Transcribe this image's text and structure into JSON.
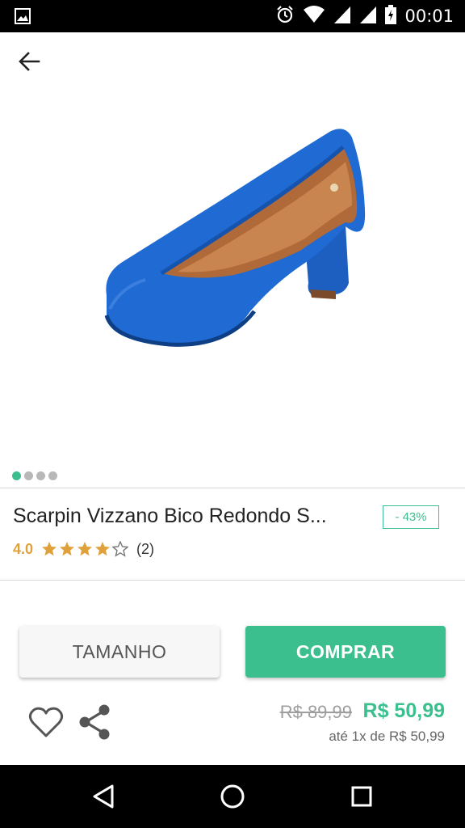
{
  "status_bar": {
    "time": "00:01",
    "icons": [
      "image-icon",
      "alarm-icon",
      "wifi-icon",
      "signal-icon",
      "signal-icon",
      "battery-icon"
    ]
  },
  "app_bar": {
    "back_icon": "arrow-back-icon"
  },
  "gallery": {
    "image_count": 4,
    "active_index": 0
  },
  "product": {
    "title": "Scarpin Vizzano Bico Redondo S...",
    "discount": "- 43%",
    "rating_value": "4.0",
    "rating_stars": 4,
    "rating_max": 5,
    "rating_count": "(2)"
  },
  "actions": {
    "size_label": "TAMANHO",
    "buy_label": "COMPRAR",
    "favorite_icon": "heart-icon",
    "share_icon": "share-icon"
  },
  "pricing": {
    "old_price": "R$ 89,99",
    "new_price": "R$ 50,99",
    "installment": "até 1x de R$ 50,99"
  },
  "nav_bar": {
    "icons": [
      "back-triangle-icon",
      "home-circle-icon",
      "recents-square-icon"
    ]
  },
  "colors": {
    "accent": "#3cbf8e",
    "rating": "#e0a13a",
    "shoe": "#1f6ad3"
  }
}
